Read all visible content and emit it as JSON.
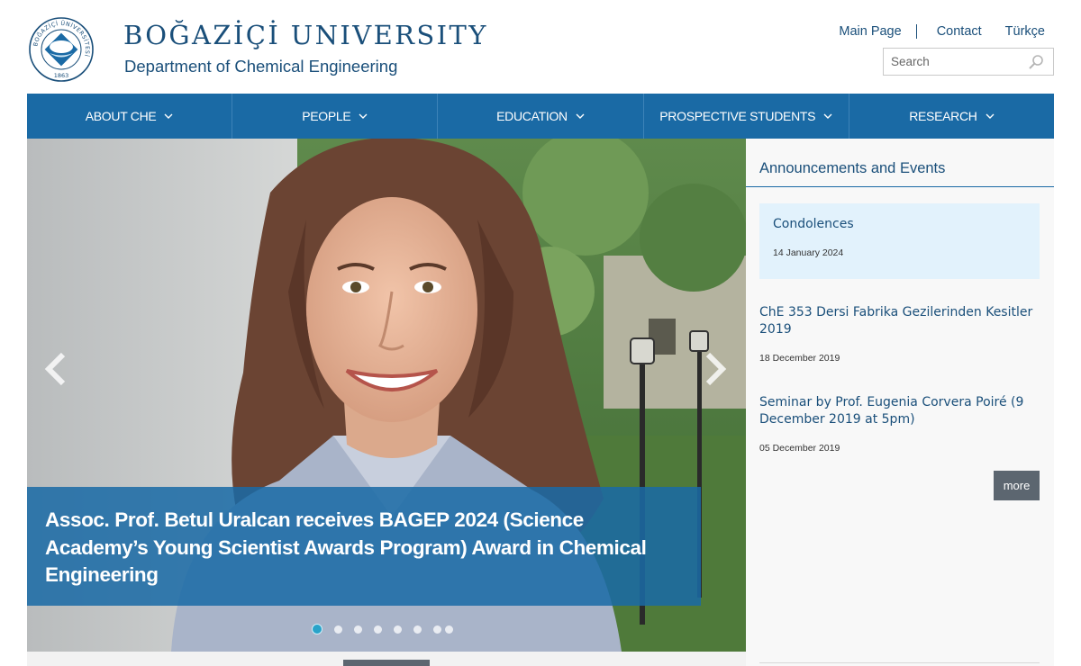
{
  "header": {
    "university": "BOĞAZİÇİ UNIVERSITY",
    "department": "Department of Chemical Engineering",
    "links": {
      "main_page": "Main Page",
      "contact": "Contact",
      "language": "Türkçe"
    },
    "search_placeholder": "Search",
    "logo_year": "1863",
    "logo_ring_text": "BOĞAZİÇİ ÜNİVERSİTESİ"
  },
  "nav": {
    "items": [
      {
        "label": "ABOUT CHE"
      },
      {
        "label": "PEOPLE"
      },
      {
        "label": "EDUCATION"
      },
      {
        "label": "PROSPECTIVE STUDENTS"
      },
      {
        "label": "RESEARCH"
      }
    ]
  },
  "slider": {
    "caption": "Assoc. Prof. Betul Uralcan receives BAGEP 2024 (Science Academy’s Young Scientist Awards Program) Award in Chemical Engineering",
    "slide_count": 8,
    "active_slide": 1
  },
  "announcements": {
    "title": "Announcements and Events",
    "items": [
      {
        "title": "Condolences",
        "date": "14 January 2024",
        "highlighted": true
      },
      {
        "title": "ChE 353 Dersi Fabrika Gezilerinden Kesitler 2019",
        "date": "18 December 2019",
        "highlighted": false
      },
      {
        "title": "Seminar by Prof. Eugenia Corvera Poiré (9 December 2019 at 5pm)",
        "date": "05 December 2019",
        "highlighted": false
      }
    ],
    "more_label": "more"
  },
  "colors": {
    "brand_blue": "#1a6aa5",
    "text_blue": "#1a4f7a",
    "highlight_bg": "#e2f2fc",
    "button_gray": "#5c6670",
    "dot_active": "#29a3c9"
  }
}
